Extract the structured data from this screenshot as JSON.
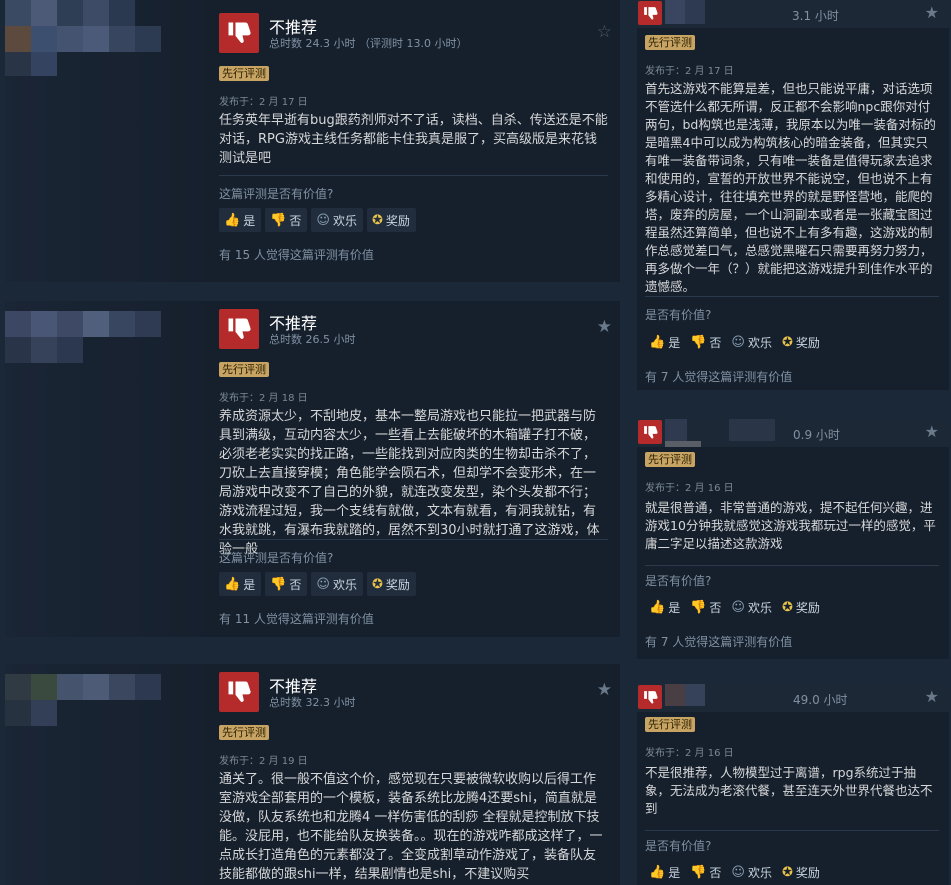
{
  "common": {
    "badge": "先行评测",
    "helpful_question": "这篇评测是否有价值?",
    "helpful_question_short": "是否有价值?",
    "votes": {
      "yes": "是",
      "no": "否",
      "funny": "欢乐",
      "award": "奖励"
    },
    "verdict": "不推荐"
  },
  "left_reviews": [
    {
      "verdict": "不推荐",
      "hours": "总时数 24.3 小时 （评测时 13.0 小时）",
      "posted": "发布于：2 月 17 日",
      "text": "任务英年早逝有bug跟药剂师对不了话，读档、自杀、传送还是不能对话，RPG游戏主线任务都能卡住我真是服了，买高级版是来花钱测试是吧",
      "helpful_count": "有 15 人觉得这篇评测有价值"
    },
    {
      "verdict": "不推荐",
      "hours": "总时数 26.5 小时",
      "posted": "发布于：2 月 18 日",
      "text": "养成资源太少，不刮地皮，基本一整局游戏也只能拉一把武器与防具到满级，互动内容太少，一些看上去能破坏的木箱罐子打不破，必须老老实实的找正路，一些能找到对应肉类的生物却击杀不了，刀砍上去直接穿模；角色能学会陨石术，但却学不会变形术，在一局游戏中改变不了自己的外貌，就连改变发型，染个头发都不行；游戏流程过短，我一个支线有就做，文本有就看，有洞我就钻，有水我就跳，有瀑布我就踏的，居然不到30小时就打通了这游戏，体验一般",
      "helpful_count": "有 11 人觉得这篇评测有价值"
    },
    {
      "verdict": "不推荐",
      "hours": "总时数 32.3 小时",
      "posted": "发布于：2 月 19 日",
      "text": "通关了。很一般不值这个价，感觉现在只要被微软收购以后得工作室游戏全部套用的一个模板，装备系统比龙腾4还要shi，简直就是没做，队友系统也和龙腾4 一样伤害低的刮痧 全程就是控制放下技能。没屁用，也不能给队友换装备。。现在的游戏咋都成这样了，一点成长打造角色的元素都没了。全变成割草动作游戏了，装备队友技能都做的跟shi一样，结果剧情也是shi，不建议购买"
    }
  ],
  "right_reviews": [
    {
      "hours": "3.1 小时",
      "posted": "发布于：2 月 17 日",
      "text": "首先这游戏不能算是差，但也只能说平庸，对话选项不管选什么都无所谓，反正都不会影响npc跟你对付两句，bd构筑也是浅薄，我原本以为唯一装备对标的是暗黑4中可以成为构筑核心的暗金装备，但其实只有唯一装备带词条，只有唯一装备是值得玩家去追求和使用的，宣誓的开放世界不能说空，但也说不上有多精心设计，往往填充世界的就是野怪营地，能爬的塔，废弃的房屋，一个山洞副本或者是一张藏宝图过程虽然还算简单，但也说不上有多有趣，这游戏的制作总感觉差口气，总感觉黑曜石只需要再努力努力，再多做个一年（？）就能把这游戏提升到佳作水平的遗憾感。",
      "helpful_count": "有 7 人觉得这篇评测有价值"
    },
    {
      "hours": "0.9 小时",
      "posted": "发布于：2 月 16 日",
      "text": "就是很普通，非常普通的游戏，提不起任何兴趣，进游戏10分钟我就感觉这游戏我都玩过一样的感觉，平庸二字足以描述这款游戏",
      "helpful_count": "有 7 人觉得这篇评测有价值"
    },
    {
      "hours": "49.0 小时",
      "posted": "发布于：2 月 16 日",
      "text": "不是很推荐，人物模型过于离谱，rpg系统过于抽象，无法成为老滚代餐，甚至连天外世界代餐也达不到"
    }
  ]
}
